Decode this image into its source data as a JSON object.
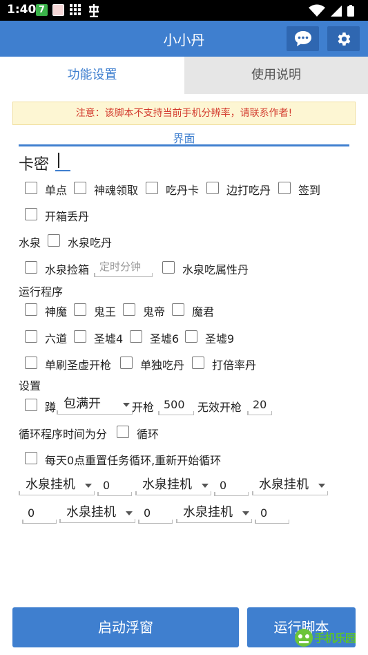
{
  "status_bar": {
    "time": "1:40",
    "icons": [
      "green-7-app-icon",
      "pink-app-icon",
      "grid-app-icon",
      "chess-symbol-icon",
      "wifi-icon",
      "signal-icon",
      "battery-icon"
    ],
    "symbol": "⿻"
  },
  "app_bar": {
    "title": "小小丹",
    "chat_icon": "chat-bubble-icon",
    "settings_icon": "gear-icon"
  },
  "tabs": [
    {
      "label": "功能设置",
      "active": true
    },
    {
      "label": "使用说明",
      "active": false
    }
  ],
  "notice": "注意：该脚本不支持当前手机分辨率，请联系作者!",
  "section_title": "界面",
  "card_key": {
    "label": "卡密",
    "value": ""
  },
  "row1": [
    {
      "label": "单点",
      "checked": false
    },
    {
      "label": "神魂领取",
      "checked": false
    },
    {
      "label": "吃丹卡",
      "checked": false
    },
    {
      "label": "边打吃丹",
      "checked": false
    },
    {
      "label": "签到",
      "checked": false
    }
  ],
  "row2": [
    {
      "label": "开箱丢丹",
      "checked": false
    }
  ],
  "water": {
    "group_label": "水泉",
    "eat": {
      "label": "水泉吃丹",
      "checked": false
    },
    "pick": {
      "label": "水泉捡箱",
      "checked": false
    },
    "timer_placeholder": "定时分钟",
    "eat_attr": {
      "label": "水泉吃属性丹",
      "checked": false
    }
  },
  "run": {
    "group_label": "运行程序",
    "row1": [
      {
        "label": "神魔"
      },
      {
        "label": "鬼王"
      },
      {
        "label": "鬼帝"
      },
      {
        "label": "魔君"
      }
    ],
    "row2": [
      {
        "label": "六道"
      },
      {
        "label": "圣墟4"
      },
      {
        "label": "圣墟6"
      },
      {
        "label": "圣墟9"
      }
    ],
    "row3": [
      {
        "label": "单刷圣虚开枪"
      },
      {
        "label": "单独吃丹"
      },
      {
        "label": "打倍率丹"
      }
    ]
  },
  "settings": {
    "group_label": "设置",
    "squat_label": "蹲",
    "dropdown": "包满开",
    "fire_label": "开枪",
    "fire_value": "500",
    "invalid_label": "无效开枪",
    "invalid_value": "20"
  },
  "loop": {
    "label": "循环程序时间为分",
    "cb_label": "循环",
    "reset_label": "每天0点重置任务循环,重新开始循环"
  },
  "schedule": {
    "row1": [
      {
        "select": "水泉挂机",
        "value": "0"
      },
      {
        "select": "水泉挂机",
        "value": "0"
      },
      {
        "select": "水泉挂机"
      }
    ],
    "row2": {
      "first_value": "0",
      "items": [
        {
          "select": "水泉挂机",
          "value": "0"
        },
        {
          "select": "水泉挂机",
          "value": "0"
        }
      ]
    }
  },
  "buttons": {
    "float": "启动浮窗",
    "run": "运行脚本"
  },
  "watermark": "手机乐园",
  "colors": {
    "primary": "#3f7fcf",
    "notice_text": "#d33b2e",
    "notice_bg": "#fdf6d3"
  }
}
